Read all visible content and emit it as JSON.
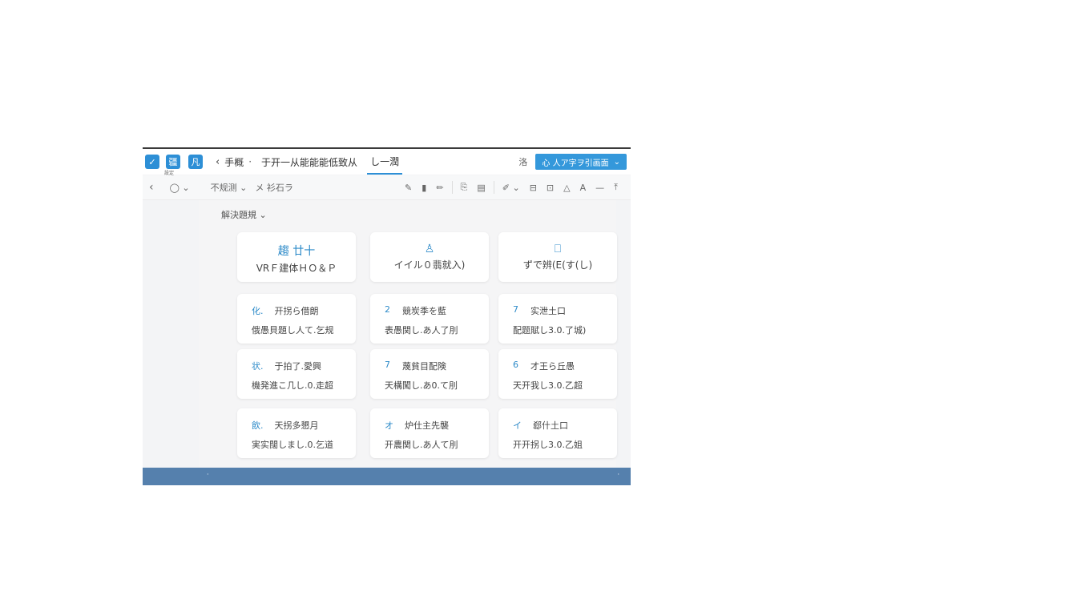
{
  "header": {
    "app_icon_1": "✓",
    "app_icon_2": "疆",
    "app_icon_2_sub": "設定",
    "app_icon_3": "凡",
    "back": "‹",
    "crumb_1": "手概",
    "separator": "·",
    "crumb_2": "于开一从能能能低致从",
    "tab_active": "し一潤",
    "small_label": "洛",
    "primary_button": "心 人ア字ヲ引画面",
    "primary_caret": "⌄"
  },
  "toolbar": {
    "back": "‹",
    "circle": "◯ ⌄",
    "dropdown_1": "不规测 ⌄",
    "dropdown_2": "メ 衫石ラ",
    "icons_a": [
      "✎",
      "▮",
      "✏"
    ],
    "icons_b": [
      "⎘",
      "▤"
    ],
    "icons_c": [
      "✐ ⌄",
      "⊟",
      "⊡",
      "△",
      "A",
      "—",
      "⤒"
    ]
  },
  "content": {
    "section_title": "解決題規 ⌄"
  },
  "top_cards": [
    {
      "icon": "趨 廿十",
      "label": "VRＦ建体ＨＯ＆Ｐ"
    },
    {
      "icon": "♙",
      "label": "イイル０翡就入)"
    },
    {
      "icon": "⎕",
      "label": "ずで辨(E(す(し)"
    }
  ],
  "item_cards": [
    {
      "num": "化.",
      "title": "开拐ら借朗",
      "sub": "俄愚貝題し人て.乞规"
    },
    {
      "num": "2",
      "title": "競炭季を藍",
      "sub": "表愚関し.あ人了刖"
    },
    {
      "num": "7",
      "title": "实泄土口",
      "sub": "配题賦し3.0.了城)"
    },
    {
      "num": "状.",
      "title": "于拍了.愛興",
      "sub": "機発進こ几し.0.走超"
    },
    {
      "num": "7",
      "title": "蔑貧目配険",
      "sub": "天構闖し.あ0.て刖"
    },
    {
      "num": "6",
      "title": "才王ら丘愚",
      "sub": "天开我し3.0.乙超"
    },
    {
      "num": "飲.",
      "title": "天拐多懇月",
      "sub": "実实闊しまし.0.乞道"
    },
    {
      "num": "オ",
      "title": "炉仕主先襲",
      "sub": "开農関し.あ人て刖"
    },
    {
      "num": "イ",
      "title": "郄什土口",
      "sub": "开开拐し3.0.乙姐"
    }
  ],
  "footer": {
    "left_mark": "·",
    "right_mark": "·"
  }
}
